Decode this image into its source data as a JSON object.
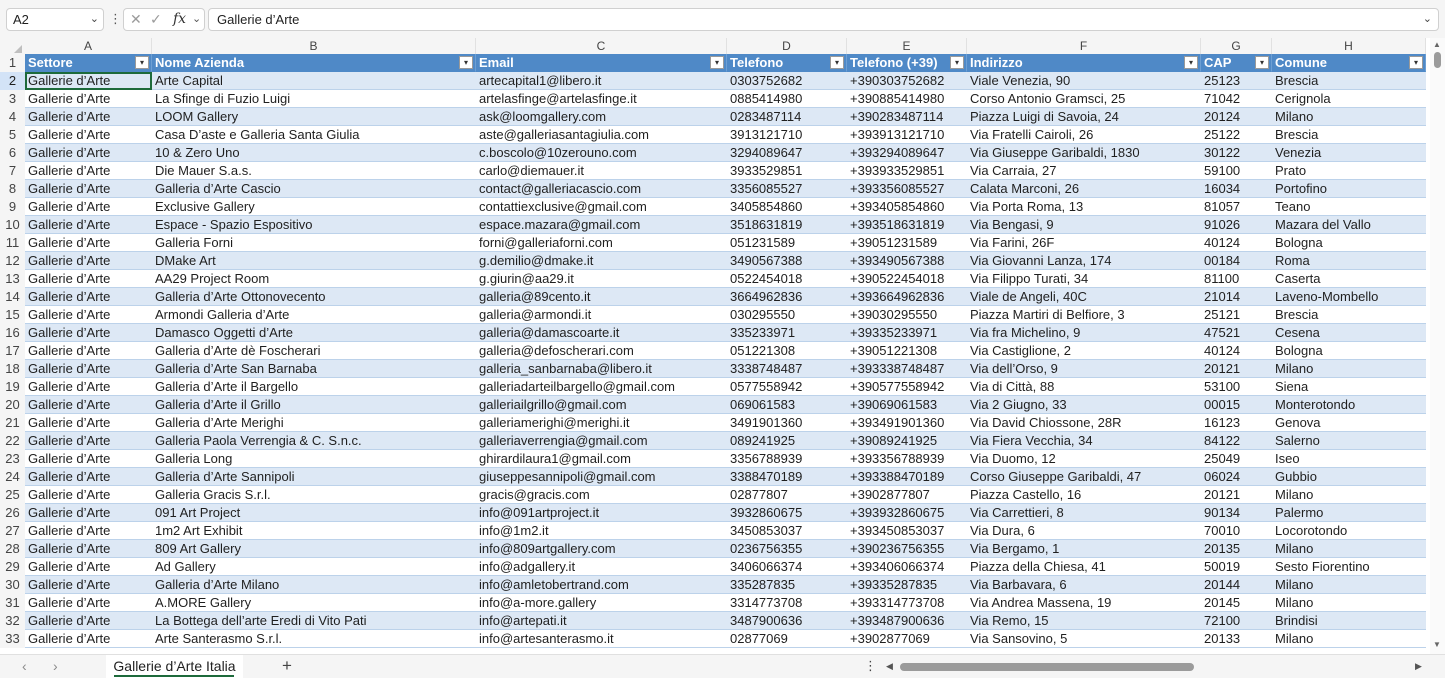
{
  "formula_bar": {
    "name_box": "A2",
    "fx_label": "fx",
    "content": "Gallerie d’Arte"
  },
  "column_letters": [
    "A",
    "B",
    "C",
    "D",
    "E",
    "F",
    "G",
    "H"
  ],
  "headers": [
    "Settore",
    "Nome Azienda",
    "Email",
    "Telefono",
    "Telefono (+39)",
    "Indirizzo",
    "CAP",
    "Comune"
  ],
  "rows": [
    [
      "Gallerie d’Arte",
      "Arte Capital",
      "artecapital1@libero.it",
      "0303752682",
      "+390303752682",
      "Viale Venezia, 90",
      "25123",
      "Brescia"
    ],
    [
      "Gallerie d’Arte",
      "La Sfinge di Fuzio Luigi",
      "artelasfinge@artelasfinge.it",
      "0885414980",
      "+390885414980",
      "Corso Antonio Gramsci, 25",
      "71042",
      "Cerignola"
    ],
    [
      "Gallerie d’Arte",
      "LOOM Gallery",
      "ask@loomgallery.com",
      "0283487114",
      "+390283487114",
      "Piazza Luigi di Savoia, 24",
      "20124",
      "Milano"
    ],
    [
      "Gallerie d’Arte",
      "Casa D’aste e Galleria Santa Giulia",
      "aste@galleriasantagiulia.com",
      "3913121710",
      "+393913121710",
      "Via Fratelli Cairoli, 26",
      "25122",
      "Brescia"
    ],
    [
      "Gallerie d’Arte",
      "10 & Zero Uno",
      "c.boscolo@10zerouno.com",
      "3294089647",
      "+393294089647",
      "Via Giuseppe Garibaldi, 1830",
      "30122",
      "Venezia"
    ],
    [
      "Gallerie d’Arte",
      "Die Mauer S.a.s.",
      "carlo@diemauer.it",
      "3933529851",
      "+393933529851",
      "Via Carraia, 27",
      "59100",
      "Prato"
    ],
    [
      "Gallerie d’Arte",
      "Galleria d’Arte Cascio",
      "contact@galleriacascio.com",
      "3356085527",
      "+393356085527",
      "Calata Marconi, 26",
      "16034",
      "Portofino"
    ],
    [
      "Gallerie d’Arte",
      "Exclusive Gallery",
      "contattiexclusive@gmail.com",
      "3405854860",
      "+393405854860",
      "Via Porta Roma, 13",
      "81057",
      "Teano"
    ],
    [
      "Gallerie d’Arte",
      "Espace - Spazio Espositivo",
      "espace.mazara@gmail.com",
      "3518631819",
      "+393518631819",
      "Via Bengasi, 9",
      "91026",
      "Mazara del Vallo"
    ],
    [
      "Gallerie d’Arte",
      "Galleria Forni",
      "forni@galleriaforni.com",
      "051231589",
      "+39051231589",
      "Via Farini, 26F",
      "40124",
      "Bologna"
    ],
    [
      "Gallerie d’Arte",
      "DMake Art",
      "g.demilio@dmake.it",
      "3490567388",
      "+393490567388",
      "Via Giovanni Lanza, 174",
      "00184",
      "Roma"
    ],
    [
      "Gallerie d’Arte",
      "AA29 Project Room",
      "g.giurin@aa29.it",
      "0522454018",
      "+390522454018",
      "Via Filippo Turati, 34",
      "81100",
      "Caserta"
    ],
    [
      "Gallerie d’Arte",
      "Galleria d’Arte Ottonovecento",
      "galleria@89cento.it",
      "3664962836",
      "+393664962836",
      "Viale de Angeli, 40C",
      "21014",
      "Laveno-Mombello"
    ],
    [
      "Gallerie d’Arte",
      "Armondi Galleria d’Arte",
      "galleria@armondi.it",
      "030295550",
      "+39030295550",
      "Piazza Martiri di Belfiore, 3",
      "25121",
      "Brescia"
    ],
    [
      "Gallerie d’Arte",
      "Damasco Oggetti d’Arte",
      "galleria@damascoarte.it",
      "335233971",
      "+39335233971",
      "Via fra Michelino, 9",
      "47521",
      "Cesena"
    ],
    [
      "Gallerie d’Arte",
      "Galleria d’Arte dè Foscherari",
      "galleria@defoscherari.com",
      "051221308",
      "+39051221308",
      "Via Castiglione, 2",
      "40124",
      "Bologna"
    ],
    [
      "Gallerie d’Arte",
      "Galleria d’Arte San Barnaba",
      "galleria_sanbarnaba@libero.it",
      "3338748487",
      "+393338748487",
      "Via dell’Orso, 9",
      "20121",
      "Milano"
    ],
    [
      "Gallerie d’Arte",
      "Galleria d’Arte il Bargello",
      "galleriadarteilbargello@gmail.com",
      "0577558942",
      "+390577558942",
      "Via di Città, 88",
      "53100",
      "Siena"
    ],
    [
      "Gallerie d’Arte",
      "Galleria d’Arte il Grillo",
      "galleriailgrillo@gmail.com",
      "069061583",
      "+39069061583",
      "Via 2 Giugno, 33",
      "00015",
      "Monterotondo"
    ],
    [
      "Gallerie d’Arte",
      "Galleria d’Arte Merighi",
      "galleriamerighi@merighi.it",
      "3491901360",
      "+393491901360",
      "Via David Chiossone, 28R",
      "16123",
      "Genova"
    ],
    [
      "Gallerie d’Arte",
      "Galleria Paola Verrengia & C. S.n.c.",
      "galleriaverrengia@gmail.com",
      "089241925",
      "+39089241925",
      "Via Fiera Vecchia, 34",
      "84122",
      "Salerno"
    ],
    [
      "Gallerie d’Arte",
      "Galleria Long",
      "ghirardilaura1@gmail.com",
      "3356788939",
      "+393356788939",
      "Via Duomo, 12",
      "25049",
      "Iseo"
    ],
    [
      "Gallerie d’Arte",
      "Galleria d’Arte Sannipoli",
      "giuseppesannipoli@gmail.com",
      "3388470189",
      "+393388470189",
      "Corso Giuseppe Garibaldi, 47",
      "06024",
      "Gubbio"
    ],
    [
      "Gallerie d’Arte",
      "Galleria Gracis S.r.l.",
      "gracis@gracis.com",
      "02877807",
      "+3902877807",
      "Piazza Castello, 16",
      "20121",
      "Milano"
    ],
    [
      "Gallerie d’Arte",
      "091 Art Project",
      "info@091artproject.it",
      "3932860675",
      "+393932860675",
      "Via Carrettieri, 8",
      "90134",
      "Palermo"
    ],
    [
      "Gallerie d’Arte",
      "1m2 Art Exhibit",
      "info@1m2.it",
      "3450853037",
      "+393450853037",
      "Via Dura, 6",
      "70010",
      "Locorotondo"
    ],
    [
      "Gallerie d’Arte",
      "809 Art Gallery",
      "info@809artgallery.com",
      "0236756355",
      "+390236756355",
      "Via Bergamo, 1",
      "20135",
      "Milano"
    ],
    [
      "Gallerie d’Arte",
      "Ad Gallery",
      "info@adgallery.it",
      "3406066374",
      "+393406066374",
      "Piazza della Chiesa, 41",
      "50019",
      "Sesto Fiorentino"
    ],
    [
      "Gallerie d’Arte",
      "Galleria d’Arte Milano",
      "info@amletobertrand.com",
      "335287835",
      "+39335287835",
      "Via Barbavara, 6",
      "20144",
      "Milano"
    ],
    [
      "Gallerie d’Arte",
      "A.MORE Gallery",
      "info@a-more.gallery",
      "3314773708",
      "+393314773708",
      "Via Andrea Massena, 19",
      "20145",
      "Milano"
    ],
    [
      "Gallerie d’Arte",
      "La Bottega dell’arte Eredi di Vito Pati",
      "info@artepati.it",
      "3487900636",
      "+393487900636",
      "Via Remo, 15",
      "72100",
      "Brindisi"
    ],
    [
      "Gallerie d’Arte",
      "Arte Santerasmo S.r.l.",
      "info@artesanterasmo.it",
      "02877069",
      "+3902877069",
      "Via Sansovino, 5",
      "20133",
      "Milano"
    ]
  ],
  "sheet_tab": "Gallerie d’Arte Italia",
  "colors": {
    "header_fill": "#4f89c7",
    "band_fill": "#dde8f5",
    "selection": "#1d6a3b"
  }
}
